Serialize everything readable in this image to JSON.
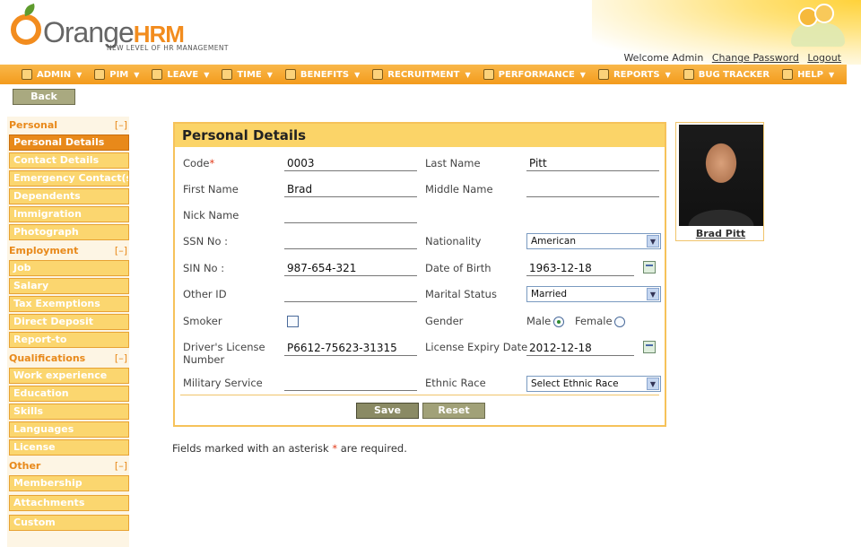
{
  "header": {
    "logo_main": "Orange",
    "logo_hrm": "HRM",
    "logo_tagline": "NEW LEVEL OF HR MANAGEMENT",
    "welcome": "Welcome Admin",
    "change_password": "Change Password",
    "logout": "Logout"
  },
  "menu": {
    "items": [
      {
        "label": "Admin",
        "icon": "admin-icon"
      },
      {
        "label": "PIM",
        "icon": "pim-icon"
      },
      {
        "label": "Leave",
        "icon": "leave-icon"
      },
      {
        "label": "Time",
        "icon": "time-icon"
      },
      {
        "label": "Benefits",
        "icon": "benefits-icon"
      },
      {
        "label": "Recruitment",
        "icon": "recruitment-icon"
      },
      {
        "label": "Performance",
        "icon": "performance-icon"
      },
      {
        "label": "Reports",
        "icon": "reports-icon"
      },
      {
        "label": "Bug Tracker",
        "icon": "bug-tracker-icon"
      },
      {
        "label": "Help",
        "icon": "help-icon"
      }
    ]
  },
  "back_label": "Back",
  "sidebar": {
    "personal": {
      "title": "Personal",
      "toggle": "[–]",
      "items": [
        "Personal Details",
        "Contact Details",
        "Emergency Contact(s)",
        "Dependents",
        "Immigration",
        "Photograph"
      ]
    },
    "employment": {
      "title": "Employment",
      "toggle": "[–]",
      "items": [
        "Job",
        "Salary",
        "Tax Exemptions",
        "Direct Deposit",
        "Report-to"
      ]
    },
    "qualifications": {
      "title": "Qualifications",
      "toggle": "[–]",
      "items": [
        "Work experience",
        "Education",
        "Skills",
        "Languages",
        "License"
      ]
    },
    "other": {
      "title": "Other",
      "toggle": "[–]",
      "items": [
        "Membership",
        "Attachments",
        "Custom"
      ]
    }
  },
  "form": {
    "title": "Personal Details",
    "labels": {
      "code": "Code",
      "last_name": "Last Name",
      "first_name": "First Name",
      "middle_name": "Middle Name",
      "nick_name": "Nick Name",
      "ssn": "SSN No :",
      "nationality": "Nationality",
      "sin": "SIN No :",
      "dob": "Date of Birth",
      "other_id": "Other ID",
      "marital_status": "Marital Status",
      "smoker": "Smoker",
      "gender": "Gender",
      "drivers_license": "Driver's License Number",
      "license_expiry": "License Expiry Date",
      "military": "Military Service",
      "ethnic_race": "Ethnic Race",
      "male": "Male",
      "female": "Female"
    },
    "values": {
      "code": "0003",
      "last_name": "Pitt",
      "first_name": "Brad",
      "middle_name": "",
      "nick_name": "",
      "ssn": "",
      "nationality": "American",
      "sin": "987-654-321",
      "dob": "1963-12-18",
      "other_id": "",
      "marital_status": "Married",
      "smoker": false,
      "gender": "Male",
      "drivers_license": "P6612-75623-31315",
      "license_expiry": "2012-12-18",
      "military": "",
      "ethnic_race": "Select Ethnic Race"
    },
    "save_label": "Save",
    "reset_label": "Reset"
  },
  "photo": {
    "name": "Brad Pitt"
  },
  "footnote": {
    "before": "Fields marked with an asterisk ",
    "asterisk": "*",
    "after": " are required."
  },
  "colors": {
    "accent": "#f39b1d",
    "panel_header": "#fbd468",
    "sidebar_item": "#fbd66f",
    "active_item": "#e8891a"
  }
}
